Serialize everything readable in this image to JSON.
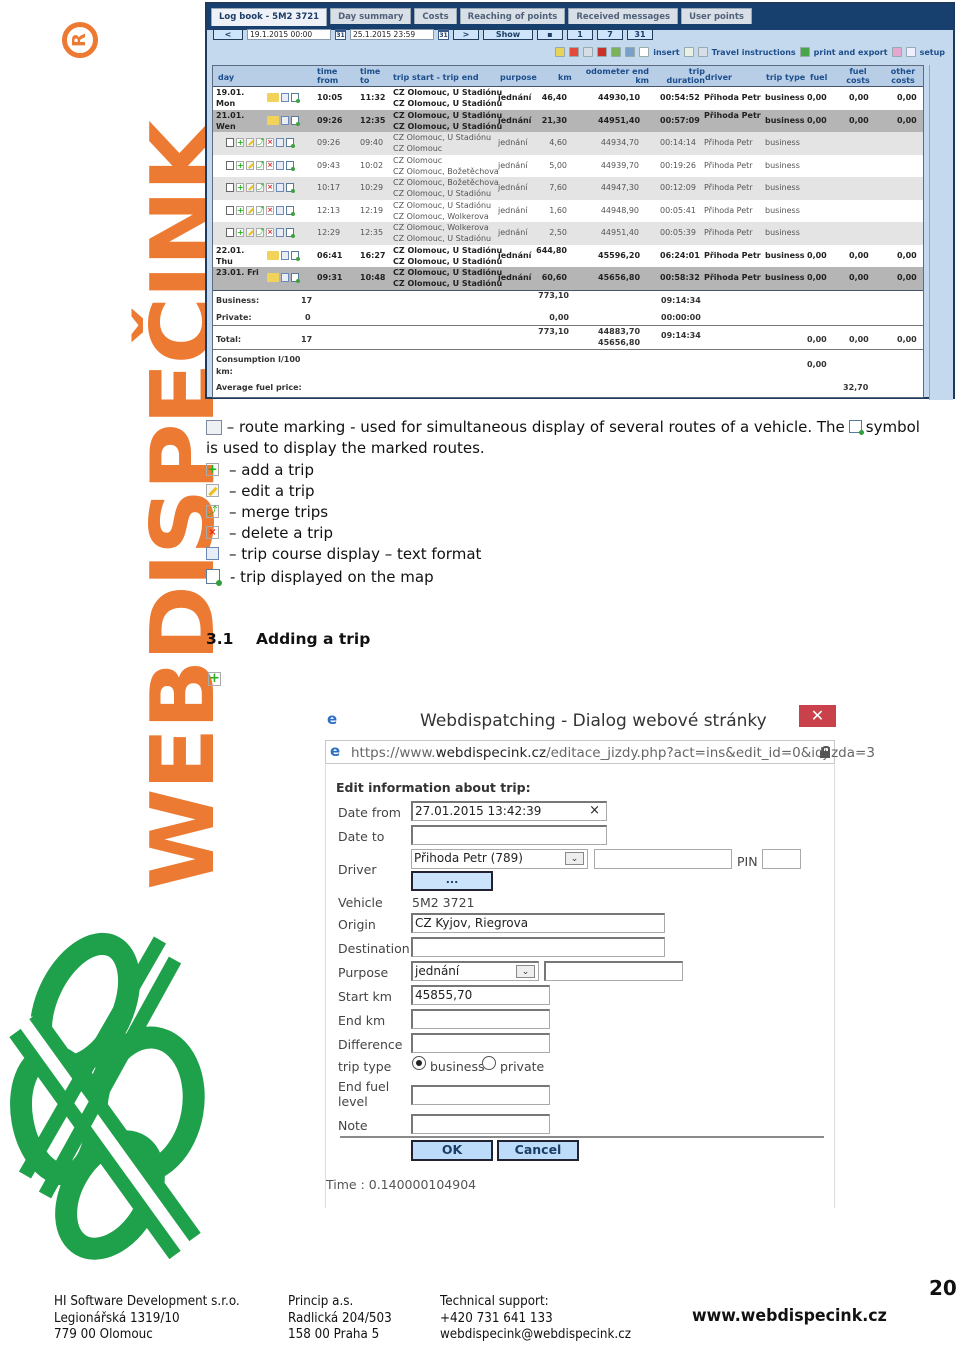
{
  "brand": {
    "logo_text": "WEBDISPEČINK",
    "registered_mark": "R",
    "orange": "#ec7a32",
    "green": "#1ea14a"
  },
  "app": {
    "tabs": [
      {
        "label": "Log book - 5M2 3721",
        "active": true
      },
      {
        "label": "Day summary",
        "active": false
      },
      {
        "label": "Costs",
        "active": false
      },
      {
        "label": "Reaching of points",
        "active": false
      },
      {
        "label": "Received messages",
        "active": false
      },
      {
        "label": "User points",
        "active": false
      }
    ],
    "toolbar": {
      "prev_label": "<",
      "date_from": "19.1.2015 00:00",
      "date_to": "25.1.2015 23:59",
      "calendar_label": "31",
      "next_label": ">",
      "show_label": "Show",
      "period_buttons": [
        "1",
        "7",
        "31"
      ],
      "insert_label": "insert",
      "travel_instructions_label": "Travel instructions",
      "print_export_label": "print and export",
      "setup_label": "setup"
    },
    "columns": {
      "day": "day",
      "time_from": "time from",
      "time_to": "time to",
      "trip": "trip start - trip end",
      "purpose": "purpose",
      "km": "km",
      "odometer": "odometer end km",
      "duration": "trip duration",
      "driver": "driver",
      "trip_type": "trip type",
      "fuel": "fuel",
      "fuel_costs": "fuel costs",
      "other_costs": "other costs"
    },
    "rows": [
      {
        "kind": "day",
        "bg": "white",
        "day": "19.01.",
        "day2": "Mon",
        "from": "10:05",
        "to": "11:32",
        "start": "CZ Olomouc, U Stadiónu",
        "end": "CZ Olomouc, U Stadiónu",
        "purpose": "jednání",
        "km": "46,40",
        "odo": "44930,10",
        "dur": "00:54:52",
        "driver": "Přihoda Petr",
        "type": "business",
        "fuel": "0,00",
        "fuel_costs": "0,00",
        "other": "0,00"
      },
      {
        "kind": "day",
        "bg": "grey",
        "day": "21.01.",
        "day2": "Wen",
        "from": "09:26",
        "to": "12:35",
        "start": "CZ Olomouc, U Stadiónu",
        "end": "CZ Olomouc, U Stadiónu",
        "purpose": "jednání",
        "km": "21,30",
        "odo": "44951,40",
        "dur": "00:57:09",
        "driver": "Přihoda Petr",
        "type": "business",
        "fuel": "0,00",
        "fuel_costs": "0,00",
        "other": "0,00"
      },
      {
        "kind": "sub",
        "bg": "lgrey",
        "from": "09:26",
        "to": "09:40",
        "start": "CZ Olomouc, U Stadiónu",
        "end": "CZ Olomouc",
        "purpose": "jednání",
        "km": "4,60",
        "odo": "44934,70",
        "dur": "00:14:14",
        "driver": "Přihoda Petr",
        "type": "business"
      },
      {
        "kind": "sub",
        "bg": "white",
        "from": "09:43",
        "to": "10:02",
        "start": "CZ Olomouc",
        "end": "CZ Olomouc, Božetěchova",
        "purpose": "jednání",
        "km": "5,00",
        "odo": "44939,70",
        "dur": "00:19:26",
        "driver": "Přihoda Petr",
        "type": "business"
      },
      {
        "kind": "sub",
        "bg": "lgrey",
        "from": "10:17",
        "to": "10:29",
        "start": "CZ Olomouc, Božetěchova",
        "end": "CZ Olomouc, U Stadiónu",
        "purpose": "jednání",
        "km": "7,60",
        "odo": "44947,30",
        "dur": "00:12:09",
        "driver": "Přihoda Petr",
        "type": "business"
      },
      {
        "kind": "sub",
        "bg": "white",
        "from": "12:13",
        "to": "12:19",
        "start": "CZ Olomouc, U Stadiónu",
        "end": "CZ Olomouc, Wolkerova",
        "purpose": "jednání",
        "km": "1,60",
        "odo": "44948,90",
        "dur": "00:05:41",
        "driver": "Přihoda Petr",
        "type": "business"
      },
      {
        "kind": "sub",
        "bg": "lgrey",
        "from": "12:29",
        "to": "12:35",
        "start": "CZ Olomouc, Wolkerova",
        "end": "CZ Olomouc, U Stadiónu",
        "purpose": "jednání",
        "km": "2,50",
        "odo": "44951,40",
        "dur": "00:05:39",
        "driver": "Přihoda Petr",
        "type": "business"
      },
      {
        "kind": "day",
        "bg": "white",
        "day": "22.01.",
        "day2": "Thu",
        "from": "06:41",
        "to": "16:27",
        "start": "CZ Olomouc, U Stadiónu",
        "end": "CZ Olomouc, U Stadiónu",
        "purpose": "jednání",
        "km": "644,80",
        "odo": "45596,20",
        "dur": "06:24:01",
        "driver": "Přihoda Petr",
        "type": "business",
        "fuel": "0,00",
        "fuel_costs": "0,00",
        "other": "0,00"
      },
      {
        "kind": "day",
        "bg": "grey",
        "day": "23.01. Fri",
        "day2": "",
        "from": "09:31",
        "to": "10:48",
        "start": "CZ Olomouc, U Stadiónu",
        "end": "CZ Olomouc, U Stadiónu",
        "purpose": "jednání",
        "km": "60,60",
        "odo": "45656,80",
        "dur": "00:58:32",
        "driver": "Přihoda Petr",
        "type": "business",
        "fuel": "0,00",
        "fuel_costs": "0,00",
        "other": "0,00"
      }
    ],
    "summary": {
      "business_label": "Business:",
      "business_count": "17",
      "business_km": "773,10",
      "business_dur": "09:14:34",
      "private_label": "Private:",
      "private_count": "0",
      "private_km": "0,00",
      "private_dur": "00:00:00",
      "total_label": "Total:",
      "total_count": "17",
      "total_km": "773,10",
      "total_odo_start": "44883,70",
      "total_odo_end": "45656,80",
      "total_dur": "09:14:34",
      "total_fuel": "0,00",
      "total_fuel_costs": "0,00",
      "total_other": "0,00",
      "consumption_label": "Consumption l/100 km:",
      "consumption_value": "0,00",
      "avg_fuel_label": "Average fuel price:",
      "avg_fuel_value": "32,70"
    }
  },
  "legend": {
    "route_marking_1": "– route marking - used for simultaneous display of several routes of a vehicle. The",
    "route_marking_2": "symbol",
    "route_marking_3": "is used to display the marked routes.",
    "items": [
      {
        "icon": "add-trip-icon",
        "text": "– add a trip"
      },
      {
        "icon": "edit-trip-icon",
        "text": "– edit a trip"
      },
      {
        "icon": "merge-trips-icon",
        "text": "– merge trips"
      },
      {
        "icon": "delete-trip-icon",
        "text": "– delete a trip"
      },
      {
        "icon": "text-format-icon",
        "text": "– trip course display – text format"
      },
      {
        "icon": "map-display-icon",
        "text": "- trip displayed on the map"
      }
    ]
  },
  "section": {
    "number": "3.1",
    "title": "Adding a trip"
  },
  "dialog": {
    "title": "Webdispatching - Dialog webové stránky",
    "close_label": "✕",
    "url_prefix": "https://www.",
    "url_domain": "webdispecink.cz",
    "url_path": "/editace_jizdy.php?act=ins&edit_id=0&idjizda=3",
    "form_heading": "Edit information about trip:",
    "labels": {
      "date_from": "Date from",
      "date_to": "Date to",
      "driver": "Driver",
      "vehicle": "Vehicle",
      "origin": "Origin",
      "destination": "Destination",
      "purpose": "Purpose",
      "start_km": "Start km",
      "end_km": "End km",
      "difference": "Difference",
      "trip_type": "trip type",
      "end_fuel": "End fuel level",
      "note": "Note",
      "pin": "PIN"
    },
    "values": {
      "date_from": "27.01.2015 13:42:39",
      "date_to": "",
      "driver": "Přihoda Petr (789)",
      "driver_extra": "",
      "pin": "",
      "vehicle": "5M2 3721",
      "origin": "CZ Kyjov, Riegrova",
      "destination": "",
      "purpose": "jednání",
      "purpose_extra": "",
      "start_km": "45855,70",
      "end_km": "",
      "difference": "",
      "end_fuel": "",
      "note": ""
    },
    "dots_label": "...",
    "trip_type_options": [
      "business",
      "private"
    ],
    "trip_type_selected": "business",
    "ok_label": "OK",
    "cancel_label": "Cancel",
    "time_text": "Time : 0.140000104904"
  },
  "footer": {
    "company": [
      "HI Software Development s.r.o.",
      "Legionářská 1319/10",
      "779 00 Olomouc"
    ],
    "partner": [
      "Princip a.s.",
      "Radlická 204/503",
      "158 00 Praha 5"
    ],
    "support": [
      "Technical support:",
      "+420 731 641 133",
      "webdispecink@webdispecink.cz"
    ],
    "website": "www.webdispecink.cz",
    "page_number": "20"
  }
}
